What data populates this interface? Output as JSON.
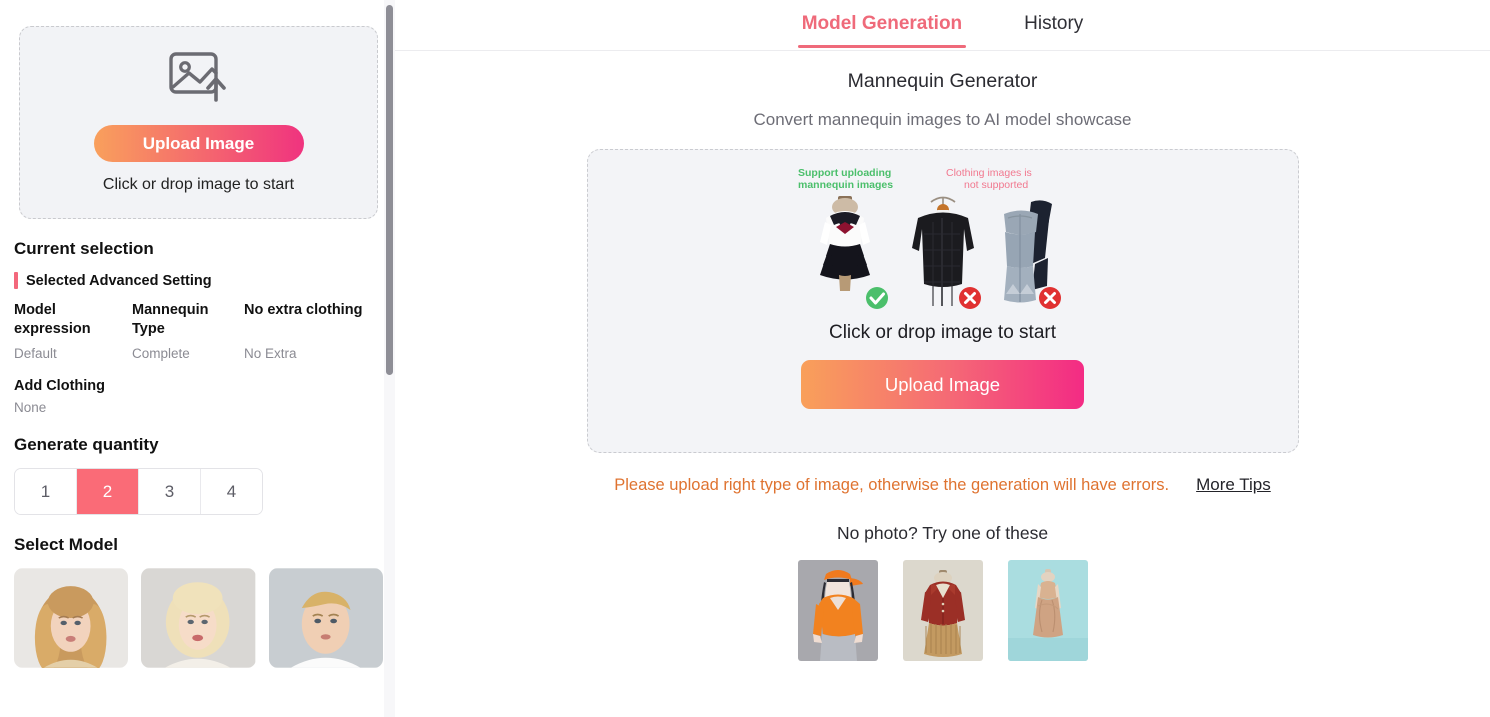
{
  "sidebar": {
    "upload_panel": {
      "icon": "image-upload-icon",
      "button_label": "Upload Image",
      "hint": "Click or drop image to start"
    },
    "current_selection": {
      "title": "Current selection",
      "selected_advanced_setting_label": "Selected Advanced Setting",
      "settings": [
        {
          "key": "Model expression",
          "value": "Default"
        },
        {
          "key": "Mannequin Type",
          "value": "Complete"
        },
        {
          "key": "No extra clothing",
          "value": "No Extra"
        }
      ],
      "add_clothing_key": "Add Clothing",
      "add_clothing_value": "None"
    },
    "generate_quantity": {
      "title": "Generate quantity",
      "options": [
        "1",
        "2",
        "3",
        "4"
      ],
      "selected": "2"
    },
    "select_model": {
      "title": "Select Model",
      "models": [
        {
          "name": "model-long-wavy-blonde-woman"
        },
        {
          "name": "model-short-blonde-woman"
        },
        {
          "name": "model-blonde-young-man"
        }
      ]
    }
  },
  "main": {
    "tabs": [
      {
        "label": "Model Generation",
        "active": true
      },
      {
        "label": "History",
        "active": false
      }
    ],
    "title": "Mannequin Generator",
    "subtitle": "Convert mannequin images to AI model showcase",
    "dropzone": {
      "illustration": {
        "supported_label": "Support uploading\nmannequin images",
        "supported_label_line1": "Support uploading",
        "supported_label_line2": "mannequin images",
        "unsupported_label_line1": "Clothing images is",
        "unsupported_label_line2": "not supported",
        "items": [
          {
            "name": "mannequin-sailor-uniform",
            "status": "check"
          },
          {
            "name": "black-puffer-jacket",
            "status": "cross"
          },
          {
            "name": "denim-flare-jeans",
            "status": "cross"
          }
        ]
      },
      "hint": "Click or drop image to start",
      "button_label": "Upload Image"
    },
    "warning": {
      "text": "Please upload right type of image, otherwise the generation will have errors.",
      "link_label": "More Tips"
    },
    "samples": {
      "title": "No photo? Try one of these",
      "items": [
        {
          "name": "sample-orange-sweater-cap-mannequin"
        },
        {
          "name": "sample-red-jacket-pleated-skirt-mannequin"
        },
        {
          "name": "sample-beige-dress-mannequin"
        }
      ]
    }
  },
  "colors": {
    "accent_pink": "#ef6a7a",
    "quantity_selected": "#fa6b77",
    "warning_orange": "#df7330",
    "support_green": "#4bbf6b",
    "unsupported_pink": "#f1788f",
    "dropzone_bg": "#f3f4f7"
  }
}
